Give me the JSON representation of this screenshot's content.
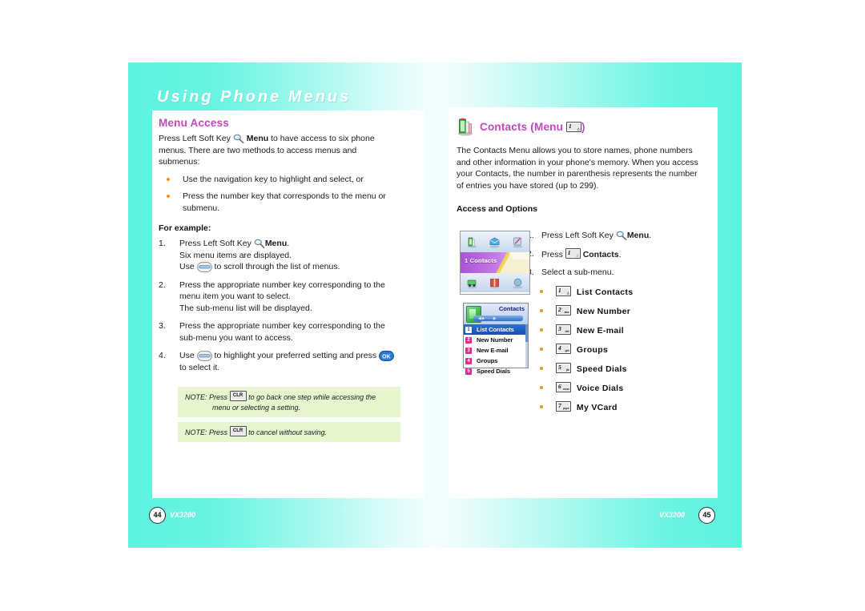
{
  "chapter": {
    "title": "Using Phone Menus"
  },
  "left_page": {
    "heading": "Menu Access",
    "intro_a": "Press Left Soft Key",
    "intro_menu": "Menu",
    "intro_b": "to have access to six phone menus. There are two methods to access menus and submenus:",
    "bullets": [
      "Use the navigation key to highlight and select, or",
      "Press the number key that corresponds to the menu or submenu."
    ],
    "for_example": "For example:",
    "steps": [
      {
        "num": "1.",
        "line1_a": "Press Left Soft Key",
        "line1_menu": "Menu",
        "line1_end": ".",
        "line2": "Six menu items are displayed.",
        "line3_a": "Use",
        "line3_b": "to scroll through the list of menus."
      },
      {
        "num": "2.",
        "line1": "Press the appropriate number key corresponding to the menu item you want to select.",
        "line2": "The sub-menu list will be displayed."
      },
      {
        "num": "3.",
        "line1": "Press the appropriate number key corresponding to the sub-menu you want to access."
      },
      {
        "num": "4.",
        "line1_a": "Use",
        "line1_b": "to highlight your preferred setting and press",
        "line1_c": "to select it.",
        "ok_label": "OK"
      }
    ],
    "notes": [
      {
        "label": "NOTE:",
        "press": "Press",
        "key": "CLR",
        "text": "to go back one step while accessing the",
        "text2": "menu or selecting a setting."
      },
      {
        "label": "NOTE:",
        "press": "Press",
        "key": "CLR",
        "text": "to cancel without saving."
      }
    ]
  },
  "right_page": {
    "heading_a": "Contacts (Menu",
    "heading_key": "1",
    "heading_key_sub": "△",
    "heading_b": ")",
    "intro": "The Contacts Menu allows you to store names, phone numbers and other information in your phone's memory. When you access your Contacts, the number in parenthesis represents the number of entries you have stored (up to 299).",
    "access_heading": "Access and Options",
    "steps": [
      {
        "num": "1.",
        "text_a": "Press Left Soft Key",
        "bold": "Menu",
        "text_b": "."
      },
      {
        "num": "2.",
        "text_a": "Press",
        "key": "1",
        "bold": "Contacts",
        "text_b": "."
      },
      {
        "num": "3.",
        "text_a": "Select a sub-menu.",
        "bold": "",
        "text_b": ""
      }
    ],
    "submenu": [
      {
        "key": "1",
        "sub": "△",
        "label": "List Contacts"
      },
      {
        "key": "2",
        "sub": "abc",
        "label": "New Number"
      },
      {
        "key": "3",
        "sub": "def",
        "label": "New E-mail"
      },
      {
        "key": "4",
        "sub": "ghi",
        "label": "Groups"
      },
      {
        "key": "5",
        "sub": "jkl",
        "label": "Speed Dials"
      },
      {
        "key": "6",
        "sub": "mno",
        "label": "Voice Dials"
      },
      {
        "key": "7",
        "sub": "pqrs",
        "label": "My VCard"
      }
    ],
    "phone_screen_1": {
      "selected_label": "1  Contacts"
    },
    "phone_screen_2": {
      "title": "Contacts",
      "items": [
        {
          "num": "1",
          "label": "List Contacts",
          "selected": true
        },
        {
          "num": "2",
          "label": "New Number",
          "selected": false
        },
        {
          "num": "3",
          "label": "New E-mail",
          "selected": false
        },
        {
          "num": "4",
          "label": "Groups",
          "selected": false
        },
        {
          "num": "5",
          "label": "Speed Dials",
          "selected": false
        }
      ]
    }
  },
  "footer": {
    "left_page_number": "44",
    "left_model": "VX3200",
    "right_model": "VX3200",
    "right_page_number": "45"
  },
  "colors": {
    "teal": "#5df3df",
    "heading_magenta": "#c247c2",
    "bullet_orange": "#f7941e",
    "note_green": "#e7f6cf",
    "select_blue": "#1a4fae"
  }
}
